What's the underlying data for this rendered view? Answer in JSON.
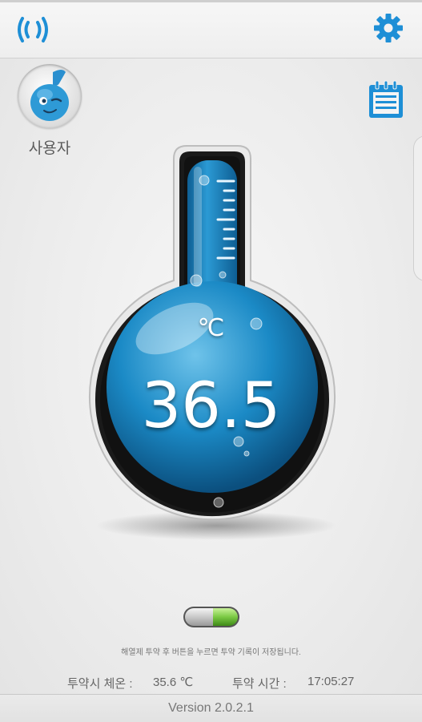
{
  "header": {
    "left_icon": "wireless-signal-icon",
    "right_icon": "gear-icon",
    "accent_color": "#1e8fd6"
  },
  "user": {
    "label": "사용자",
    "avatar_icon": "mascot-avatar-icon"
  },
  "calendar_icon": "calendar-list-icon",
  "thermometer": {
    "unit": "℃",
    "value": "36.5",
    "color": "#1e93cf"
  },
  "toggle": {
    "state": "on",
    "on_color": "#7ac943"
  },
  "hint_text": "해열제 투약 후 버튼을 누르면 투약 기록이 저장됩니다.",
  "dose_info": {
    "temp_label": "투약시 체온 :",
    "temp_value": "35.6 ℃",
    "time_label": "투약 시간 :",
    "time_value": "17:05:27"
  },
  "footer": {
    "version": "Version 2.0.2.1"
  }
}
